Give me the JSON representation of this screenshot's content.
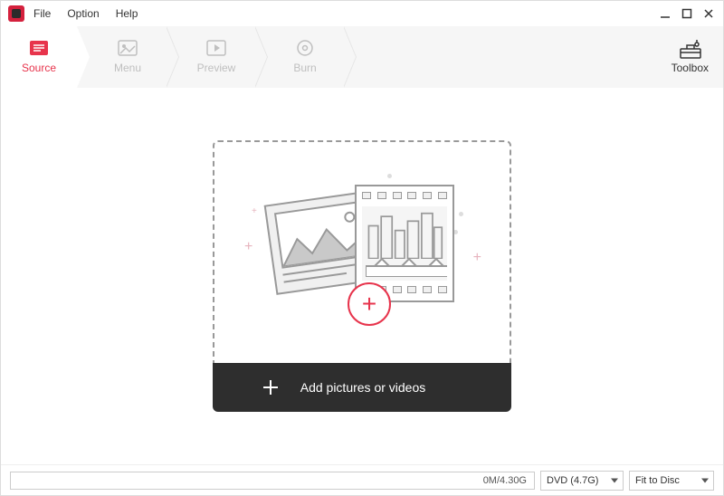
{
  "menubar": {
    "file": "File",
    "option": "Option",
    "help": "Help"
  },
  "tabs": [
    {
      "label": "Source",
      "active": true
    },
    {
      "label": "Menu",
      "active": false
    },
    {
      "label": "Preview",
      "active": false
    },
    {
      "label": "Burn",
      "active": false
    }
  ],
  "toolbox": {
    "label": "Toolbox"
  },
  "dropzone": {
    "add_label": "Add pictures or videos"
  },
  "statusbar": {
    "progress_text": "0M/4.30G",
    "disc_type": "DVD (4.7G)",
    "fit_mode": "Fit to Disc"
  },
  "colors": {
    "accent": "#e7344c",
    "dark": "#2e2e2e"
  }
}
